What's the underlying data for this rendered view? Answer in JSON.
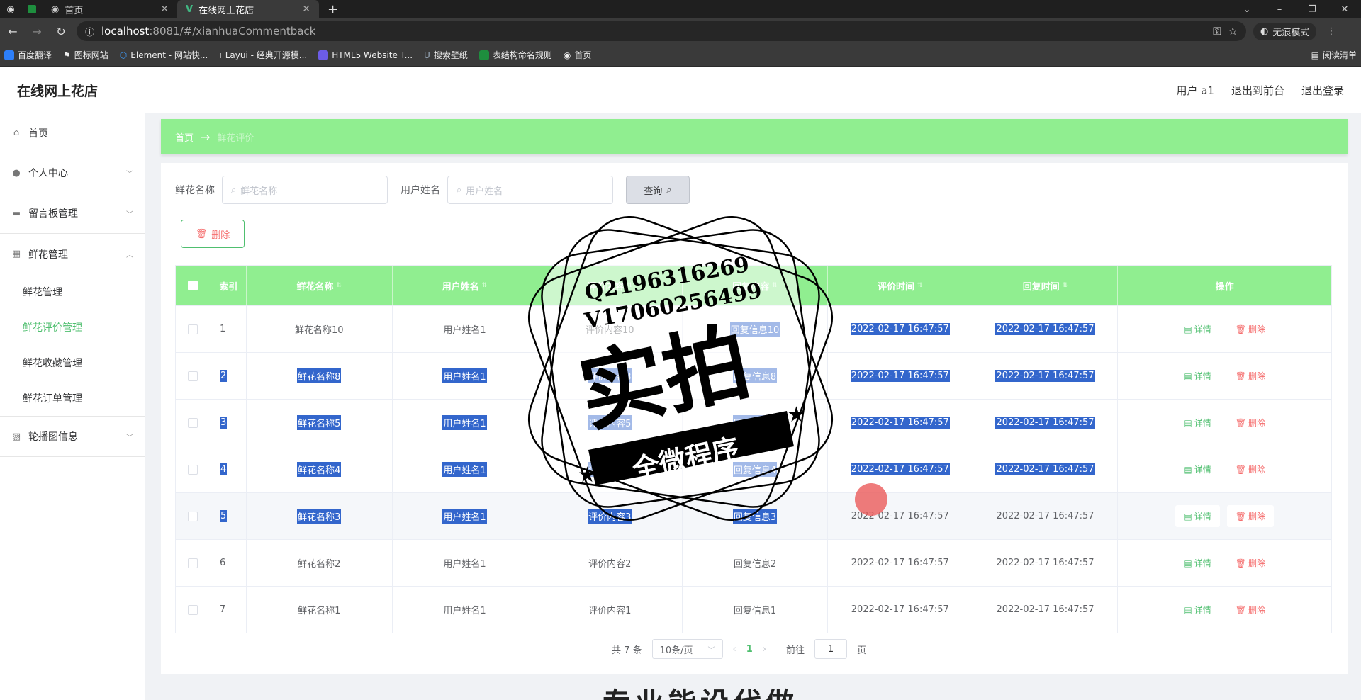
{
  "browser": {
    "tabs": [
      {
        "label": "首页",
        "active": false
      },
      {
        "label": "在线网上花店",
        "active": true
      }
    ],
    "url_host": "localhost",
    "url_path": ":8081/#/xianhuaCommentback",
    "incognito_label": "无痕模式",
    "bookmarks": [
      "百度翻译",
      "图标网站",
      "Element - 网站快...",
      "Layui - 经典开源模...",
      "HTML5 Website T...",
      "搜索壁纸",
      "表结构命名规则",
      "首页"
    ],
    "reading_list": "阅读清单"
  },
  "header": {
    "logo": "在线网上花店",
    "user": "用户 a1",
    "to_front": "退出到前台",
    "logout": "退出登录"
  },
  "sidebar": {
    "items": [
      {
        "label": "首页",
        "icon": "home-icon"
      },
      {
        "label": "个人中心",
        "icon": "user-icon"
      },
      {
        "label": "留言板管理",
        "icon": "message-icon"
      },
      {
        "label": "鲜花管理",
        "icon": "grid-icon"
      }
    ],
    "sub_items": [
      "鲜花管理",
      "鲜花评价管理",
      "鲜花收藏管理",
      "鲜花订单管理"
    ],
    "carousel": "轮播图信息"
  },
  "breadcrumb": {
    "home": "首页",
    "current": "鲜花评价"
  },
  "search": {
    "flower_label": "鲜花名称",
    "flower_placeholder": "鲜花名称",
    "user_label": "用户姓名",
    "user_placeholder": "用户姓名",
    "query_button": "查询"
  },
  "delete_button": "删除",
  "table": {
    "headers": [
      "索引",
      "鲜花名称",
      "用户姓名",
      "评价内容",
      "回复内容",
      "评价时间",
      "回复时间",
      "操作"
    ],
    "rows": [
      {
        "index": "1",
        "name": "鲜花名称10",
        "user": "用户姓名1",
        "content": "评价内容10",
        "reply": "回复信息10",
        "time1": "2022-02-17 16:47:57",
        "time2": "2022-02-17 16:47:57"
      },
      {
        "index": "2",
        "name": "鲜花名称8",
        "user": "用户姓名1",
        "content": "评价内容8",
        "reply": "回复信息8",
        "time1": "2022-02-17 16:47:57",
        "time2": "2022-02-17 16:47:57"
      },
      {
        "index": "3",
        "name": "鲜花名称5",
        "user": "用户姓名1",
        "content": "评价内容5",
        "reply": "回复信息5",
        "time1": "2022-02-17 16:47:57",
        "time2": "2022-02-17 16:47:57"
      },
      {
        "index": "4",
        "name": "鲜花名称4",
        "user": "用户姓名1",
        "content": "评价内容4",
        "reply": "回复信息4",
        "time1": "2022-02-17 16:47:57",
        "time2": "2022-02-17 16:47:57"
      },
      {
        "index": "5",
        "name": "鲜花名称3",
        "user": "用户姓名1",
        "content": "评价内容3",
        "reply": "回复信息3",
        "time1": "2022-02-17 16:47:57",
        "time2": "2022-02-17 16:47:57"
      },
      {
        "index": "6",
        "name": "鲜花名称2",
        "user": "用户姓名1",
        "content": "评价内容2",
        "reply": "回复信息2",
        "time1": "2022-02-17 16:47:57",
        "time2": "2022-02-17 16:47:57"
      },
      {
        "index": "7",
        "name": "鲜花名称1",
        "user": "用户姓名1",
        "content": "评价内容1",
        "reply": "回复信息1",
        "time1": "2022-02-17 16:47:57",
        "time2": "2022-02-17 16:47:57"
      }
    ],
    "detail_label": "详情",
    "delete_label": "删除"
  },
  "pagination": {
    "total": "共 7 条",
    "page_size": "10条/页",
    "current": "1",
    "goto_label": "前往",
    "goto_value": "1",
    "page_suffix": "页"
  },
  "watermark": {
    "contact1": "Q2196316269",
    "contact2": "V17060256499",
    "big": "实拍",
    "banner": "全微程序",
    "bottom": "专业能设代做"
  },
  "colors": {
    "accent": "#90ee90",
    "active_text": "#4fbf6f",
    "danger": "#f56c6c",
    "selection": "#3366cc"
  }
}
